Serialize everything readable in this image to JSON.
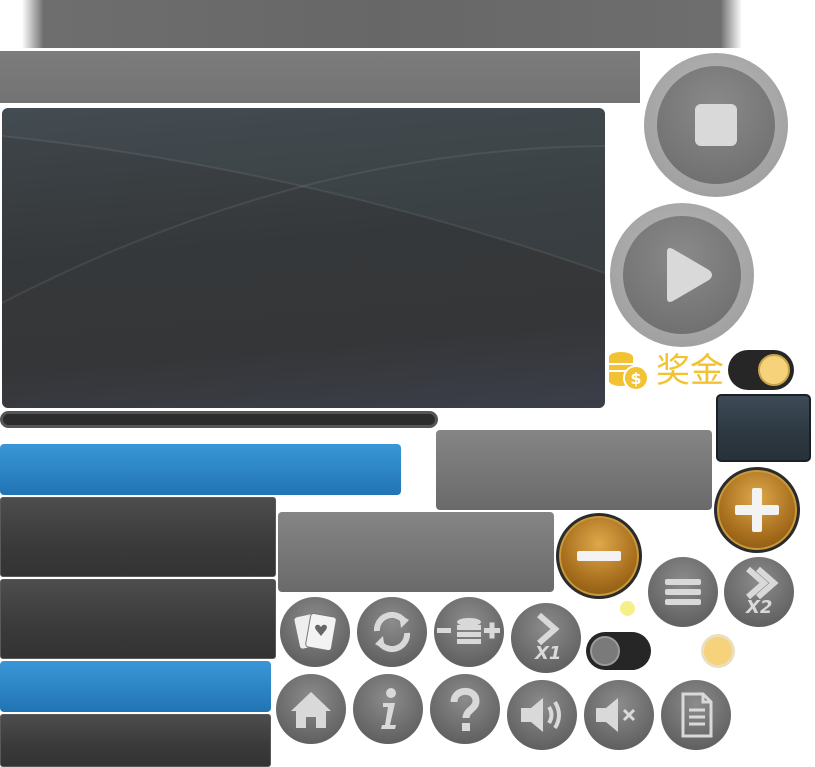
{
  "bonus": {
    "label": "奖金"
  },
  "speed": {
    "x1_label": "X1",
    "x2_label": "X2"
  },
  "icons": [
    "cards-icon",
    "refresh-icon",
    "bet-adjust-icon",
    "speed-x1-icon",
    "home-icon",
    "info-icon",
    "help-icon",
    "sound-on-icon",
    "sound-off-icon",
    "paytable-icon",
    "menu-icon",
    "speed-x2-icon",
    "stop-icon",
    "play-icon",
    "plus-icon",
    "minus-icon",
    "coins-icon"
  ],
  "toggles": {
    "bonus_toggle_on": true,
    "sound_toggle_on": false
  },
  "colors": {
    "accent_gold": "#f2c233",
    "button_blue": "#2a86c6",
    "panel_dark": "#353638"
  }
}
